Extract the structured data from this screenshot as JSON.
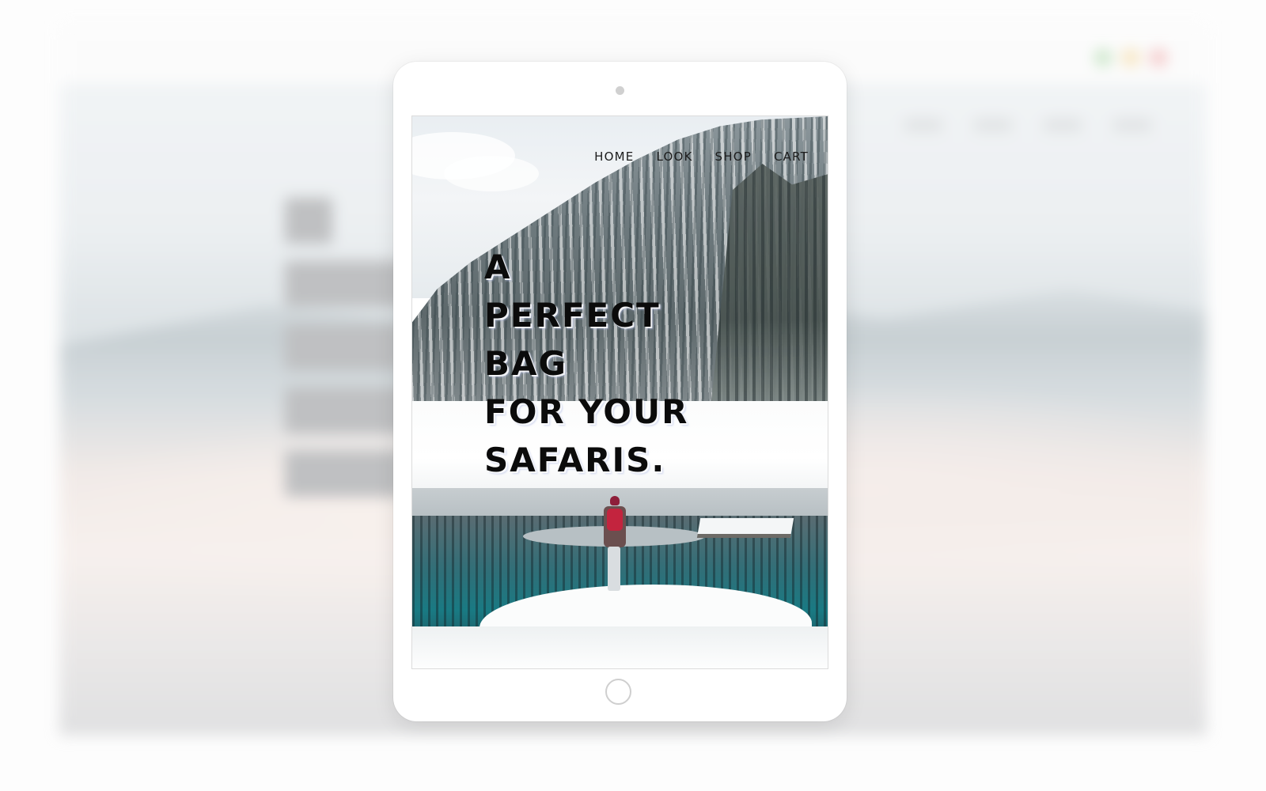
{
  "site": {
    "nav": {
      "items": [
        "HOME",
        "LOOK",
        "SHOP",
        "CART"
      ]
    },
    "hero": {
      "lines": [
        "A",
        "PERFECT",
        "BAG",
        "FOR YOUR",
        "SAFARIS."
      ]
    }
  },
  "colors": {
    "hero_text": "#0b0b0b",
    "nav_text": "#1c1c1c",
    "tablet_frame": "#ffffff",
    "lake": "#197a83",
    "backpack": "#c3243e"
  }
}
